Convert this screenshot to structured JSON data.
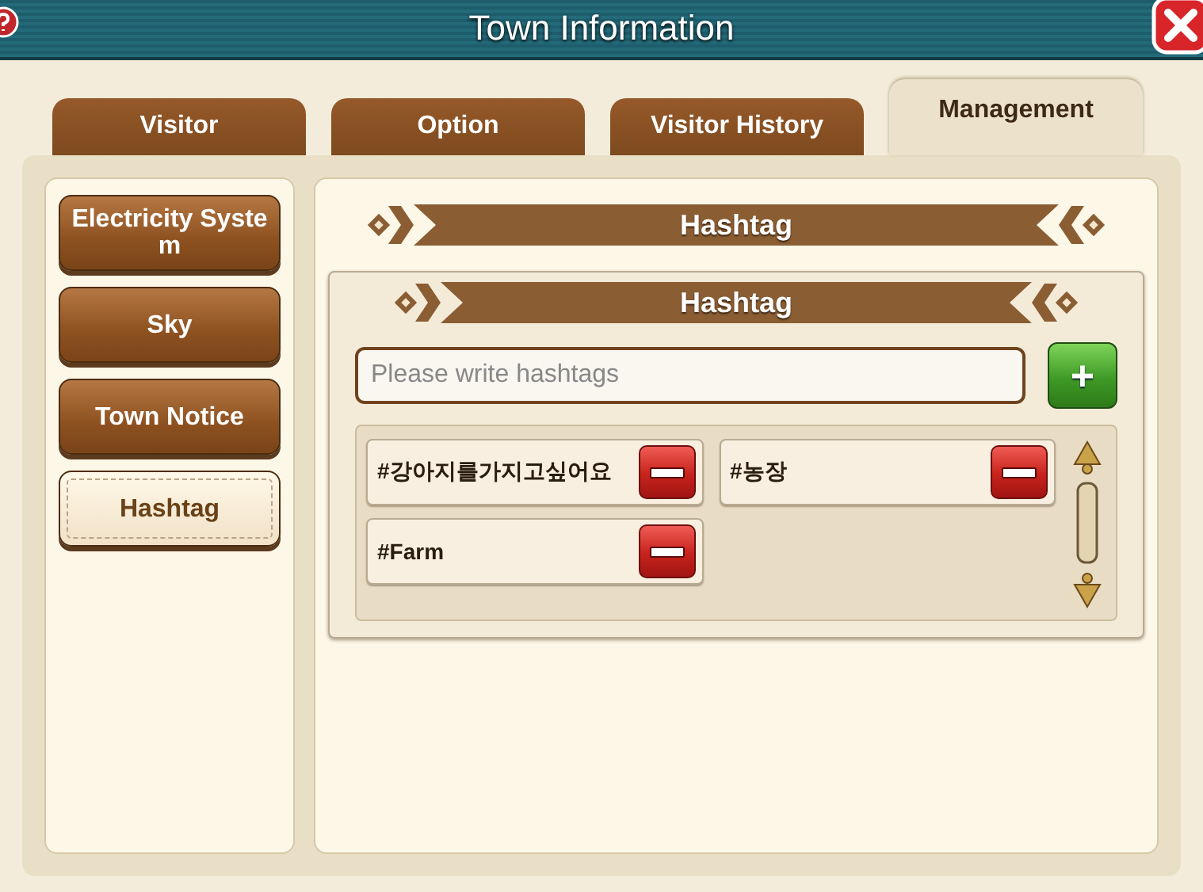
{
  "window": {
    "title": "Town Information"
  },
  "tabs": [
    {
      "label": "Visitor",
      "selected": false
    },
    {
      "label": "Option",
      "selected": false
    },
    {
      "label": "Visitor History",
      "selected": false
    },
    {
      "label": "Management",
      "selected": true
    }
  ],
  "sidebar": {
    "items": [
      {
        "label": "Electricity System",
        "selected": false
      },
      {
        "label": "Sky",
        "selected": false
      },
      {
        "label": "Town Notice",
        "selected": false
      },
      {
        "label": "Hashtag",
        "selected": true
      }
    ]
  },
  "section": {
    "title": "Hashtag",
    "card": {
      "title": "Hashtag",
      "search": {
        "placeholder": "Please write hashtags"
      },
      "add_button": "+",
      "tags": [
        {
          "label": "#강아지를가지고싶어요"
        },
        {
          "label": "#농장"
        },
        {
          "label": "#Farm"
        }
      ]
    }
  }
}
